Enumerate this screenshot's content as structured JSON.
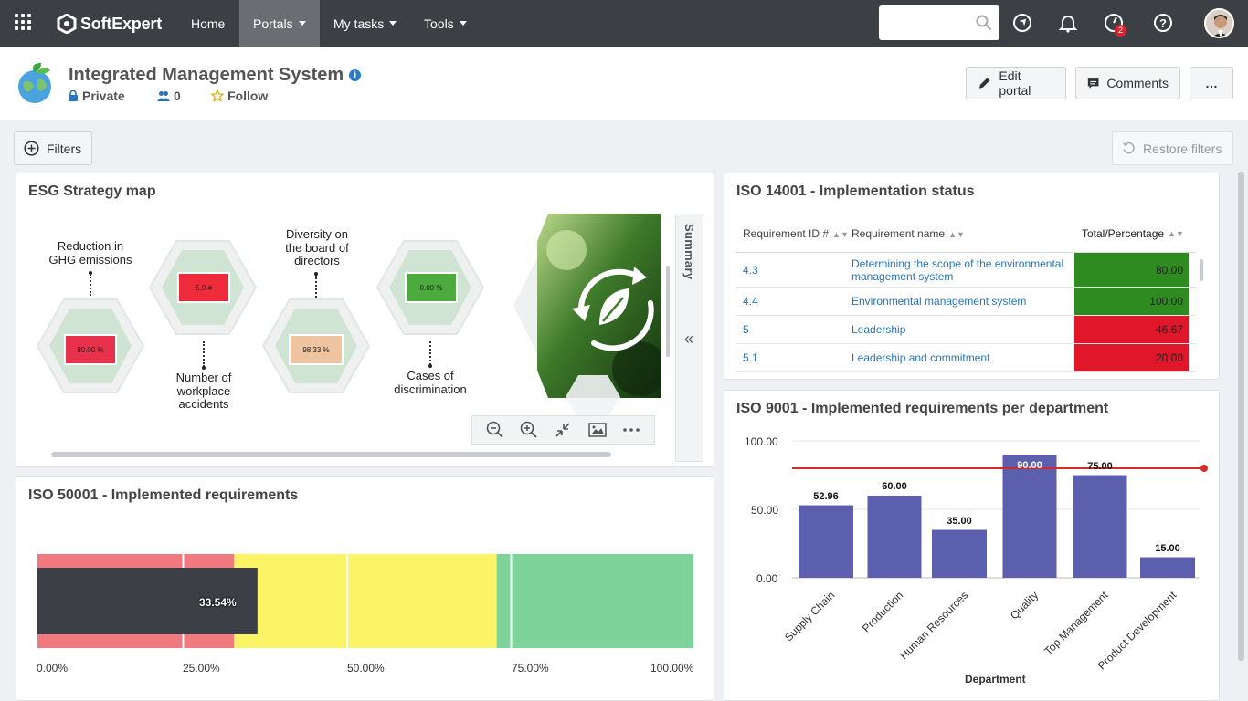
{
  "nav": {
    "brand": "SoftExpert",
    "items": [
      {
        "label": "Home",
        "dropdown": false
      },
      {
        "label": "Portals",
        "dropdown": true
      },
      {
        "label": "My tasks",
        "dropdown": true
      },
      {
        "label": "Tools",
        "dropdown": true
      }
    ],
    "search_placeholder": "",
    "notification_badge": "2"
  },
  "portal": {
    "title": "Integrated Management System",
    "privacy": "Private",
    "members": "0",
    "follow": "Follow",
    "edit_label": "Edit portal",
    "comments_label": "Comments",
    "more_label": "…"
  },
  "filters": {
    "filters_label": "Filters",
    "restore_label": "Restore filters"
  },
  "esg_map": {
    "title": "ESG Strategy map",
    "summary_label": "Summary",
    "collapse_label": "«",
    "nodes": [
      {
        "label": "Reduction in\nGHG emissions",
        "value": "80.00 %",
        "color": "#e8314a"
      },
      {
        "label": "Number of\nworkplace\naccidents",
        "value": "5.0 #",
        "color": "#ee2b3b"
      },
      {
        "label": "Diversity on\nthe board of\ndirectors",
        "value": "98.33 %",
        "color": "#efc4a0"
      },
      {
        "label": "Cases of\ndiscrimination",
        "value": "0.00 %",
        "color": "#4caa3e"
      }
    ],
    "tools": [
      "zoom-out-icon",
      "zoom-in-icon",
      "fit-icon",
      "image-icon",
      "more-icon"
    ]
  },
  "iso14001": {
    "title": "ISO 14001 - Implementation status",
    "columns": [
      "Requirement ID #",
      "Requirement name",
      "Total/Percentage"
    ],
    "rows": [
      {
        "id": "4.3",
        "name": "Determining the scope of the environmental management system",
        "value": "80.00",
        "color": "#2e8b1f"
      },
      {
        "id": "4.4",
        "name": "Environmental management system",
        "value": "100.00",
        "color": "#2e8b1f"
      },
      {
        "id": "5",
        "name": "Leadership",
        "value": "46.67",
        "color": "#e0172a"
      },
      {
        "id": "5.1",
        "name": "Leadership and commitment",
        "value": "20.00",
        "color": "#e0172a"
      }
    ]
  },
  "iso50001": {
    "title": "ISO 50001 - Implemented requirements",
    "value_label": "33.54%",
    "ticks": [
      "0.00%",
      "25.00%",
      "50.00%",
      "75.00%",
      "100.00%"
    ]
  },
  "iso9001": {
    "title": "ISO 9001 - Implemented requirements per department",
    "xlabel": "Department",
    "yticks": [
      "0.00",
      "50.00",
      "100.00"
    ]
  },
  "chart_data": [
    {
      "type": "bar",
      "title": "ISO 9001 - Implemented requirements per department",
      "xlabel": "Department",
      "ylabel": "",
      "categories": [
        "Supply Chain",
        "Production",
        "Human Resources",
        "Quality",
        "Top Management",
        "Product Development"
      ],
      "values": [
        52.96,
        60.0,
        35.0,
        90.0,
        75.0,
        15.0
      ],
      "value_labels": [
        "52.96",
        "60.00",
        "35.00",
        "90.00",
        "75.00",
        "15.00"
      ],
      "ylim": [
        0,
        100
      ],
      "target_line": 80,
      "bar_color": "#5b5fae",
      "target_color": "#d42a2a",
      "grid": true
    },
    {
      "type": "bar",
      "title": "ISO 50001 - Implemented requirements",
      "orientation": "horizontal",
      "values": [
        33.54
      ],
      "xlim": [
        0,
        100
      ],
      "bands": [
        {
          "from": 0,
          "to": 30,
          "color": "#f07a80"
        },
        {
          "from": 30,
          "to": 70,
          "color": "#fbf467"
        },
        {
          "from": 70,
          "to": 100,
          "color": "#7ed39a"
        }
      ]
    }
  ]
}
